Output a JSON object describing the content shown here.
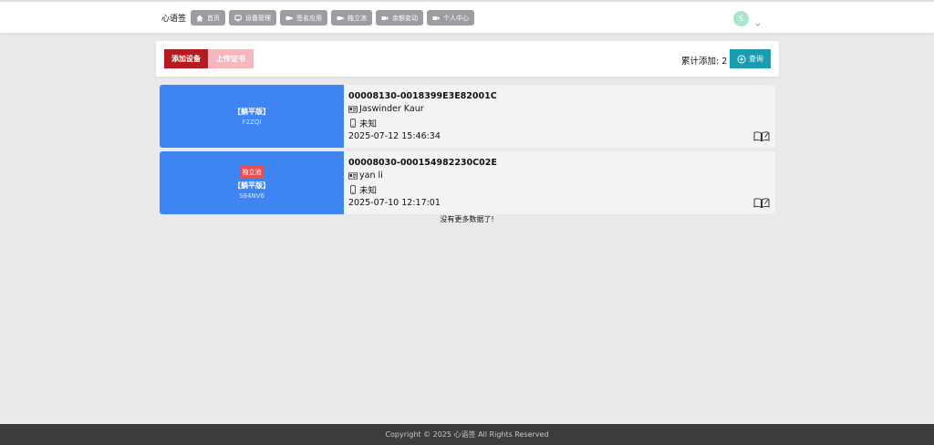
{
  "header": {
    "brand": "心语签",
    "nav": [
      {
        "label": "首页",
        "icon": "home-icon"
      },
      {
        "label": "设备管理",
        "icon": "device-icon"
      },
      {
        "label": "签名应用",
        "icon": "video-icon"
      },
      {
        "label": "独立池",
        "icon": "video-icon"
      },
      {
        "label": "余额变动",
        "icon": "video-icon"
      },
      {
        "label": "个人中心",
        "icon": "video-icon"
      }
    ],
    "avatar_letter": "S"
  },
  "toolbar": {
    "add_label": "添加设备",
    "upload_label": "上传证书",
    "count_label": "累计添加: 2",
    "query_label": "查询"
  },
  "devices": [
    {
      "tag": "",
      "edition": "【躺平版】",
      "code": "F2ZQI",
      "udid": "00008130-0018399E3E82001C",
      "name": "Jaswinder Kaur",
      "model": "未知",
      "date": "2025-07-12 15:46:34"
    },
    {
      "tag": "独立池",
      "edition": "【躺平版】",
      "code": "S84NV6",
      "udid": "00008030-000154982230C02E",
      "name": "yan li",
      "model": "未知",
      "date": "2025-07-10 12:17:01"
    }
  ],
  "no_more": "没有更多数据了!",
  "footer": "Copyright © 2025 心语签 All Rights Reserved",
  "colors": {
    "primary_red": "#b51c22",
    "upload_pink": "#f7b6bd",
    "query_teal": "#1a9db0",
    "card_blue": "#3e84f3",
    "tag_red": "#e95050"
  }
}
